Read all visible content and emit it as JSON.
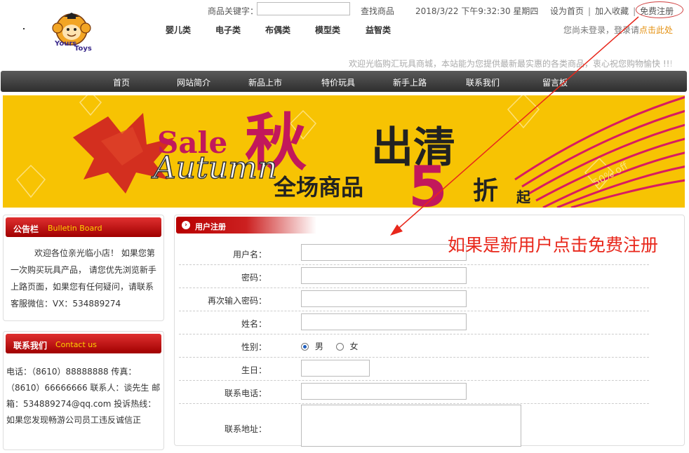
{
  "header": {
    "logo_text_top": "Yours",
    "logo_text_bottom": "Toys",
    "search_label": "商品关键字：",
    "search_value": "",
    "search_button": "查找商品",
    "datetime": "2018/3/22 下午9:32:30 星期四",
    "set_homepage": "设为首页",
    "add_favorite": "加入收藏",
    "separator": "|",
    "register": "免费注册",
    "categories": [
      "婴儿类",
      "电子类",
      "布偶类",
      "模型类",
      "益智类"
    ],
    "login_prompt": "您尚未登录，登录请",
    "login_link": "点击此处",
    "welcome": "欢迎光临购汇玩具商城，本站能为您提供最新最实惠的各类商品，衷心祝您购物愉快 !!!"
  },
  "nav": {
    "items": [
      "首页",
      "网站简介",
      "新品上市",
      "特价玩具",
      "新手上路",
      "联系我们",
      "留言板"
    ]
  },
  "banner": {
    "sale": "Sale",
    "autumn_cn": "秋",
    "clearance": "出清",
    "autumn_en": "Autumn",
    "all_items": "全场商品",
    "discount_num": "5",
    "discount_unit": "折",
    "from": "起",
    "badge": "50% off"
  },
  "bulletin": {
    "title_cn": "公告栏",
    "title_en": "Bulletin Board",
    "text": "欢迎各位亲光临小店！ 如果您第一次购买玩具产品， 请您优先浏览新手上路页面，如果您有任何疑问，请联系客服微信：VX：534889274"
  },
  "contact": {
    "title_cn": "联系我们",
    "title_en": "Contact us",
    "text": "电话：（8610）88888888 传真：（8610）66666666 联系人：谈先生 邮箱：534889274@qq.com 投诉热线：如果您发现畅游公司员工违反诚信正"
  },
  "register_form": {
    "title": "用户注册",
    "fields": {
      "username": "用户名：",
      "password": "密码：",
      "password_confirm": "再次输入密码：",
      "name": "姓名：",
      "gender": "性别：",
      "birthday": "生日：",
      "phone": "联系电话：",
      "address": "联系地址："
    },
    "gender_options": [
      "男",
      "女"
    ],
    "gender_selected": "男"
  },
  "annotation": {
    "hint": "如果是新用户点击免费注册",
    "color": "#e8271b"
  },
  "colors": {
    "nav_bg": "#3a3a3a",
    "panel_red": "#b80000",
    "banner_yellow": "#f6c000",
    "link_orange": "#e49010"
  }
}
